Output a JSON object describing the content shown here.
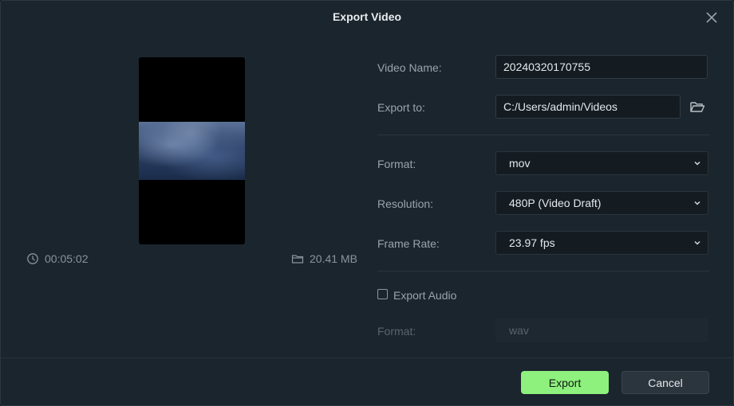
{
  "dialog": {
    "title": "Export Video"
  },
  "preview": {
    "duration": "00:05:02",
    "file_size": "20.41 MB"
  },
  "form": {
    "video_name": {
      "label": "Video Name:",
      "value": "20240320170755"
    },
    "export_to": {
      "label": "Export to:",
      "value": "C:/Users/admin/Videos"
    },
    "format": {
      "label": "Format:",
      "value": "mov"
    },
    "resolution": {
      "label": "Resolution:",
      "value": "480P (Video Draft)"
    },
    "frame_rate": {
      "label": "Frame Rate:",
      "value": "23.97 fps"
    },
    "export_audio": {
      "label": "Export Audio",
      "checked": false
    },
    "audio_format": {
      "label": "Format:",
      "value": "wav"
    }
  },
  "buttons": {
    "export": "Export",
    "cancel": "Cancel"
  },
  "colors": {
    "accent": "#8ef07d",
    "background": "#1b252d",
    "field": "#141c22"
  }
}
